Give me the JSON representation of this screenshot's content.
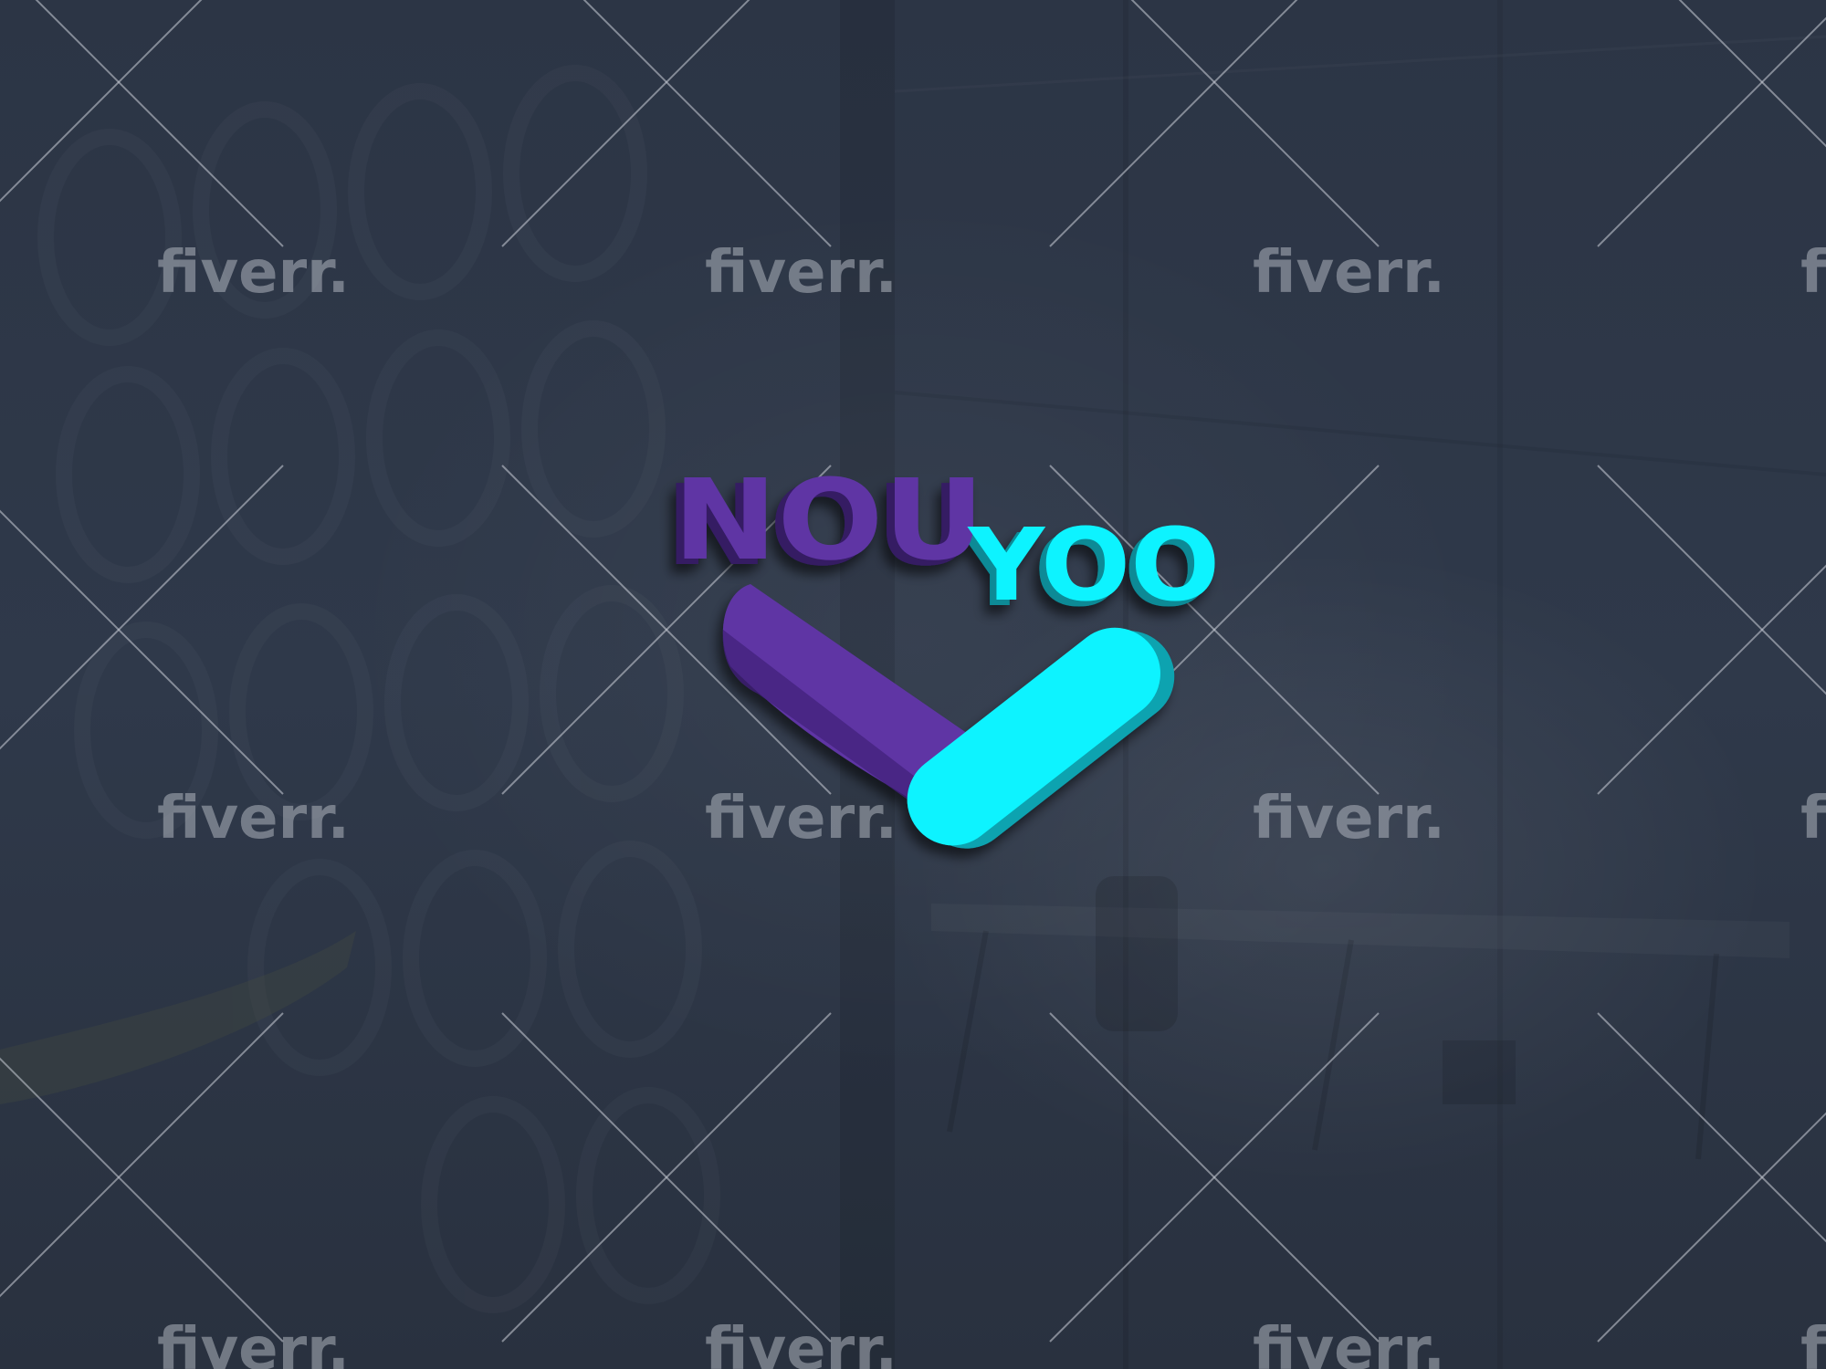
{
  "logo": {
    "word_left": "NOU",
    "word_right": "YOO",
    "color_left": "#5e35a4",
    "color_right": "#10f3ff",
    "mark": "check-mark-icon"
  },
  "watermark": {
    "text": "fiverr.",
    "cross": "cross-mark-icon"
  },
  "colors": {
    "background": "#2b3443",
    "watermark": "#aeb3bd"
  }
}
